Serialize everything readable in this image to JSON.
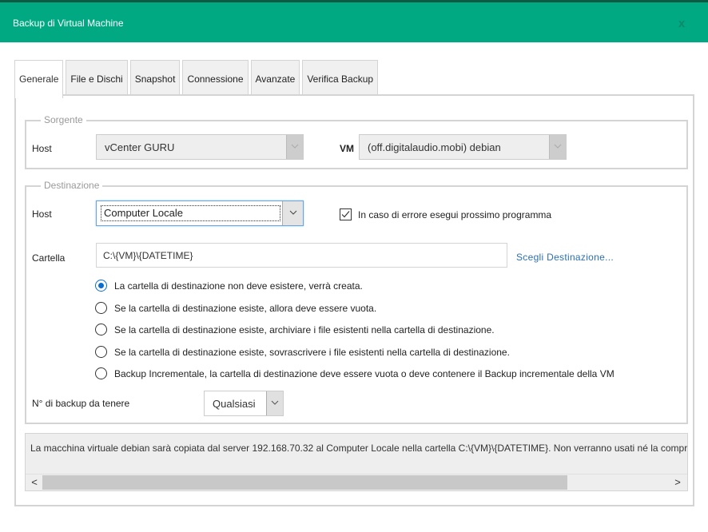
{
  "window": {
    "title": "Backup di Virtual Machine",
    "close_glyph": "x",
    "accent_color": "#01a982"
  },
  "tabs": [
    {
      "label": "Generale",
      "active": true
    },
    {
      "label": "File e Dischi",
      "active": false
    },
    {
      "label": "Snapshot",
      "active": false
    },
    {
      "label": "Connessione",
      "active": false
    },
    {
      "label": "Avanzate",
      "active": false
    },
    {
      "label": "Verifica Backup",
      "active": false
    }
  ],
  "source": {
    "legend": "Sorgente",
    "host_label": "Host",
    "host_value": "vCenter GURU",
    "vm_label": "VM",
    "vm_value": "(off.digitalaudio.mobi) debian"
  },
  "destination": {
    "legend": "Destinazione",
    "host_label": "Host",
    "host_value": "Computer Locale",
    "on_error_checkbox": {
      "label": "In caso di errore esegui prossimo programma",
      "checked": true
    },
    "folder_label": "Cartella",
    "folder_value": "C:\\{VM}\\{DATETIME}",
    "choose_link": "Scegli Destinazione...",
    "options": [
      {
        "label": "La cartella di destinazione non deve esistere, verrà creata.",
        "selected": true
      },
      {
        "label": "Se la cartella di destinazione esiste, allora deve essere vuota.",
        "selected": false
      },
      {
        "label": "Se la cartella di destinazione esiste, archiviare i file esistenti nella cartella di destinazione.",
        "selected": false
      },
      {
        "label": "Se la cartella di destinazione esiste, sovrascrivere i file esistenti nella cartella di destinazione.",
        "selected": false
      },
      {
        "label": "Backup Incrementale, la cartella di destinazione deve essere vuota o deve contenere il Backup incrementale della VM",
        "selected": false
      }
    ],
    "keep_label": "N° di backup da tenere",
    "keep_value": "Qualsiasi"
  },
  "summary": {
    "text": "La macchina virtuale debian sarà copiata dal server 192.168.70.32 al Computer Locale nella cartella C:\\{VM}\\{DATETIME}. Non verranno usati né la compre",
    "scroll_left": "<",
    "scroll_right": ">",
    "scroll_thumb_fraction": 0.8
  }
}
